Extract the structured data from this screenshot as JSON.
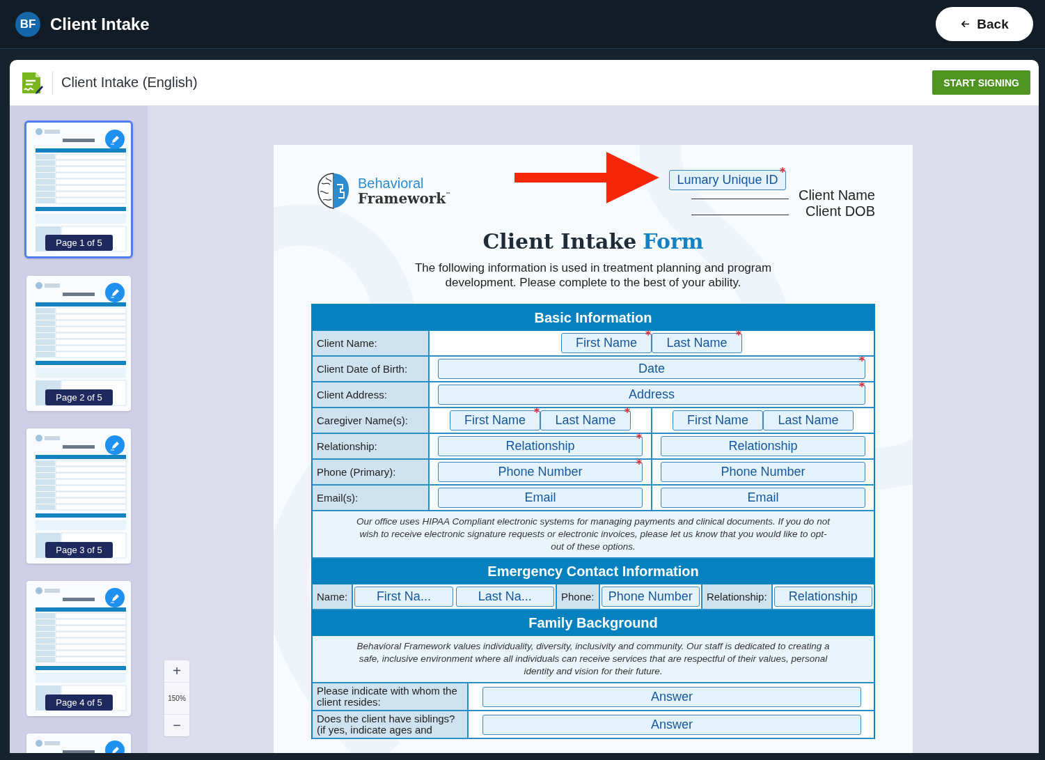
{
  "app_bar": {
    "avatar": "BF",
    "title": "Client Intake",
    "back_label": "Back"
  },
  "document_header": {
    "title": "Client Intake (English)",
    "action": "START SIGNING"
  },
  "thumbnails": [
    {
      "label": "Page 1 of 5",
      "selected": true
    },
    {
      "label": "Page 2 of 5",
      "selected": false
    },
    {
      "label": "Page 3 of 5",
      "selected": false
    },
    {
      "label": "Page 4 of 5",
      "selected": false
    },
    {
      "selected": false
    }
  ],
  "zoom": {
    "zoom_in": "+",
    "level_text": "150%",
    "zoom_out": "−"
  },
  "form": {
    "brand_line_1": "Behavioral",
    "brand_line_2": "Framework",
    "brand_mark": "™",
    "id_field": {
      "placeholder": "Lumary Unique ID",
      "required": true
    },
    "header_lines": [
      "Client Name",
      "Client DOB"
    ],
    "title": "Client Intake",
    "title_accent": "Form",
    "intro": "The following information is used in treatment planning and program development. Please complete to the best of your ability.",
    "sections": [
      {
        "heading": "Basic Information",
        "rows": [
          {
            "kind": "fields",
            "label": "Client Name:",
            "groups": [
              [
                {
                  "placeholder": "First Name",
                  "required": true
                },
                {
                  "placeholder": "Last Name",
                  "required": true
                }
              ]
            ]
          },
          {
            "kind": "fields",
            "label": "Client Date of Birth:",
            "groups": [
              [
                {
                  "placeholder": "Date",
                  "required": true
                }
              ]
            ]
          },
          {
            "kind": "fields",
            "label": "Client Address:",
            "groups": [
              [
                {
                  "placeholder": "Address",
                  "required": true
                }
              ]
            ]
          },
          {
            "kind": "fields",
            "label": "Caregiver Name(s):",
            "groups": [
              [
                {
                  "placeholder": "First Name",
                  "required": true
                },
                {
                  "placeholder": "Last Name",
                  "required": true
                }
              ],
              [
                {
                  "placeholder": "First Name",
                  "required": false
                },
                {
                  "placeholder": "Last Name",
                  "required": false
                }
              ]
            ]
          },
          {
            "kind": "fields",
            "label": "Relationship:",
            "groups": [
              [
                {
                  "placeholder": "Relationship",
                  "required": true
                }
              ],
              [
                {
                  "placeholder": "Relationship",
                  "required": false
                }
              ]
            ]
          },
          {
            "kind": "fields",
            "label": "Phone (Primary):",
            "groups": [
              [
                {
                  "placeholder": "Phone Number",
                  "required": true
                }
              ],
              [
                {
                  "placeholder": "Phone Number",
                  "required": false
                }
              ]
            ]
          },
          {
            "kind": "fields",
            "label": "Email(s):",
            "groups": [
              [
                {
                  "placeholder": "Email",
                  "required": false
                }
              ],
              [
                {
                  "placeholder": "Email",
                  "required": false
                }
              ]
            ]
          },
          {
            "kind": "note",
            "text": "Our office uses HIPAA Compliant electronic systems for managing payments and clinical documents. If you do not wish to receive electronic signature requests or electronic invoices, please let us know that you would like to opt-out of these options."
          }
        ]
      },
      {
        "heading": "Emergency Contact Information",
        "rows": [
          {
            "kind": "inline",
            "items": [
              {
                "kind": "label",
                "text": "Name:"
              },
              {
                "kind": "field",
                "placeholder": "First Na...",
                "required": false
              },
              {
                "kind": "field",
                "placeholder": "Last Na...",
                "required": false
              },
              {
                "kind": "label",
                "text": "Phone:"
              },
              {
                "kind": "field",
                "placeholder": "Phone Number",
                "required": false
              },
              {
                "kind": "label",
                "text": "Relationship:"
              },
              {
                "kind": "field",
                "placeholder": "Relationship",
                "required": false
              }
            ]
          }
        ]
      },
      {
        "heading": "Family Background",
        "rows": [
          {
            "kind": "note",
            "text": "Behavioral Framework values individuality, diversity, inclusivity and community. Our staff is dedicated to creating a safe, inclusive environment where all individuals can receive services that are respectful of their values, personal identity and vision for their future."
          },
          {
            "kind": "question",
            "label": "Please indicate with whom the client resides:",
            "groups": [
              [
                {
                  "placeholder": "Answer",
                  "required": false
                }
              ]
            ]
          },
          {
            "kind": "question",
            "label": "Does the client have siblings? (if yes, indicate ages and",
            "groups": [
              [
                {
                  "placeholder": "Answer",
                  "required": false
                }
              ]
            ]
          }
        ]
      }
    ]
  }
}
